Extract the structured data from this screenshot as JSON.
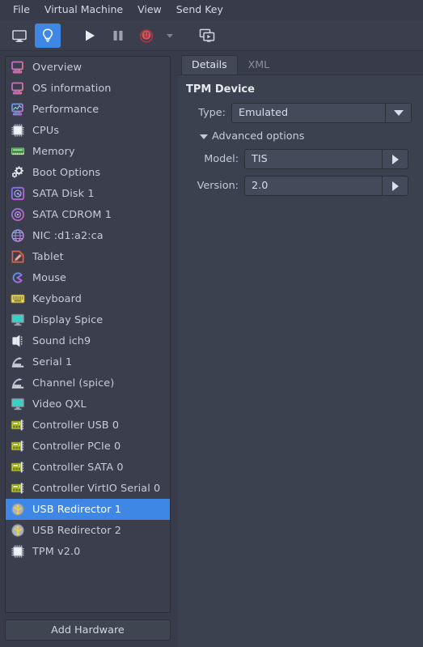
{
  "menubar": {
    "items": [
      {
        "label": "File",
        "name": "menu-file"
      },
      {
        "label": "Virtual Machine",
        "name": "menu-virtual-machine"
      },
      {
        "label": "View",
        "name": "menu-view"
      },
      {
        "label": "Send Key",
        "name": "menu-send-key"
      }
    ]
  },
  "toolbar": {
    "buttons": [
      {
        "icon": "console-monitor-icon",
        "name": "show-console-button",
        "active": false
      },
      {
        "icon": "lightbulb-details-icon",
        "name": "show-details-button",
        "active": true
      },
      {
        "icon": "play-icon",
        "name": "run-vm-button",
        "active": false
      },
      {
        "icon": "pause-icon",
        "name": "pause-vm-button",
        "active": false
      },
      {
        "icon": "power-off-icon",
        "name": "shutdown-vm-button",
        "active": false
      },
      {
        "icon": "chevron-down-icon",
        "name": "shutdown-options-dropdown",
        "active": false
      },
      {
        "icon": "snapshots-icon",
        "name": "manage-snapshots-button",
        "active": false
      }
    ]
  },
  "sidebar": {
    "add_hardware_label": "Add Hardware",
    "selected_index": 21,
    "items": [
      {
        "label": "Overview",
        "icon": "monitor-icon",
        "name": "sidebar-item-overview"
      },
      {
        "label": "OS information",
        "icon": "monitor-icon",
        "name": "sidebar-item-os-information"
      },
      {
        "label": "Performance",
        "icon": "performance-graph-icon",
        "name": "sidebar-item-performance"
      },
      {
        "label": "CPUs",
        "icon": "cpu-chip-icon",
        "name": "sidebar-item-cpus"
      },
      {
        "label": "Memory",
        "icon": "memory-ram-icon",
        "name": "sidebar-item-memory"
      },
      {
        "label": "Boot Options",
        "icon": "gears-icon",
        "name": "sidebar-item-boot-options"
      },
      {
        "label": "SATA Disk 1",
        "icon": "hard-disk-icon",
        "name": "sidebar-item-sata-disk-1"
      },
      {
        "label": "SATA CDROM 1",
        "icon": "cdrom-disc-icon",
        "name": "sidebar-item-sata-cdrom-1"
      },
      {
        "label": "NIC :d1:a2:ca",
        "icon": "network-globe-icon",
        "name": "sidebar-item-nic"
      },
      {
        "label": "Tablet",
        "icon": "tablet-pen-icon",
        "name": "sidebar-item-tablet"
      },
      {
        "label": "Mouse",
        "icon": "mouse-icon",
        "name": "sidebar-item-mouse"
      },
      {
        "label": "Keyboard",
        "icon": "keyboard-icon",
        "name": "sidebar-item-keyboard"
      },
      {
        "label": "Display Spice",
        "icon": "display-screen-icon",
        "name": "sidebar-item-display-spice"
      },
      {
        "label": "Sound ich9",
        "icon": "sound-speaker-icon",
        "name": "sidebar-item-sound-ich9"
      },
      {
        "label": "Serial 1",
        "icon": "serial-port-icon",
        "name": "sidebar-item-serial-1"
      },
      {
        "label": "Channel (spice)",
        "icon": "serial-port-icon",
        "name": "sidebar-item-channel-spice"
      },
      {
        "label": "Video QXL",
        "icon": "display-screen-icon",
        "name": "sidebar-item-video-qxl"
      },
      {
        "label": "Controller USB 0",
        "icon": "controller-card-icon",
        "name": "sidebar-item-controller-usb-0"
      },
      {
        "label": "Controller PCIe 0",
        "icon": "controller-card-icon",
        "name": "sidebar-item-controller-pcie-0"
      },
      {
        "label": "Controller SATA 0",
        "icon": "controller-card-icon",
        "name": "sidebar-item-controller-sata-0"
      },
      {
        "label": "Controller VirtIO Serial 0",
        "icon": "controller-card-icon",
        "name": "sidebar-item-controller-virtio-serial-0"
      },
      {
        "label": "USB Redirector 1",
        "icon": "usb-icon",
        "name": "sidebar-item-usb-redirector-1"
      },
      {
        "label": "USB Redirector 2",
        "icon": "usb-icon",
        "name": "sidebar-item-usb-redirector-2"
      },
      {
        "label": "TPM v2.0",
        "icon": "cpu-chip-icon",
        "name": "sidebar-item-tpm-v2-0"
      }
    ]
  },
  "details": {
    "tabs": [
      {
        "label": "Details",
        "name": "tab-details",
        "active": true
      },
      {
        "label": "XML",
        "name": "tab-xml",
        "active": false
      }
    ],
    "section_title": "TPM Device",
    "type_label": "Type:",
    "type_value": "Emulated",
    "advanced_label": "Advanced options",
    "advanced_expanded": true,
    "model_label": "Model:",
    "model_value": "TIS",
    "version_label": "Version:",
    "version_value": "2.0"
  },
  "colors": {
    "window_bg": "#383c4a",
    "panel_bg": "#3c4150",
    "list_bg": "#3b3f4d",
    "accent": "#3f87e5",
    "text": "#d3dae3"
  }
}
